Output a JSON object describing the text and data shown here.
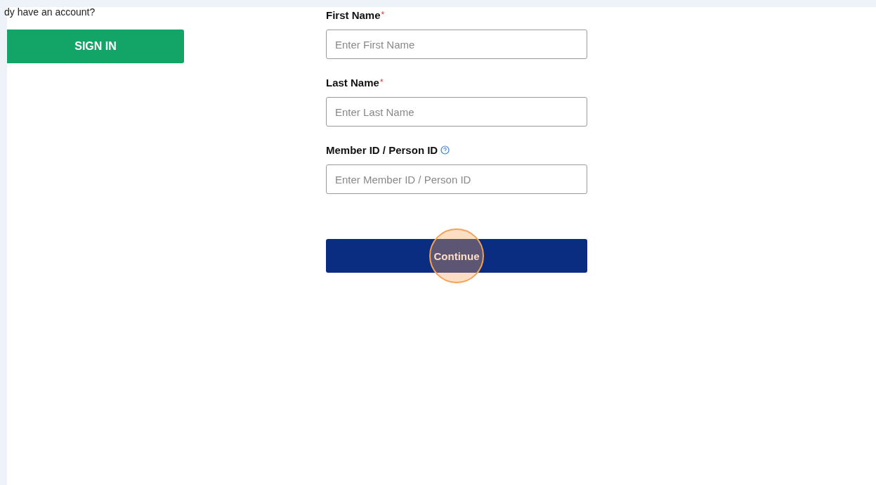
{
  "sign_in": {
    "prompt": "dy have an account?",
    "button": "SIGN IN"
  },
  "form": {
    "fields": [
      {
        "label": "First Name",
        "required": true,
        "help": false,
        "placeholder": "Enter First Name"
      },
      {
        "label": "Last Name",
        "required": true,
        "help": false,
        "placeholder": "Enter Last Name"
      },
      {
        "label": "Member ID / Person ID",
        "required": false,
        "help": true,
        "placeholder": "Enter Member ID / Person ID"
      }
    ],
    "asterisk": "*",
    "submit": {
      "label": "Continue",
      "clicked": true
    }
  }
}
